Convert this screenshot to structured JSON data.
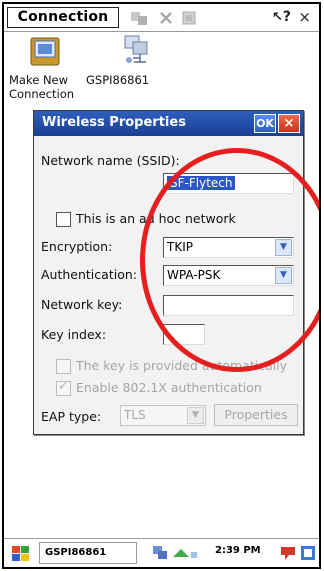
{
  "menubar": {
    "title": "Connection",
    "help_symbol": "?",
    "close_symbol": "×"
  },
  "desktop": {
    "icons": [
      {
        "label_line1": "Make New",
        "label_line2": "Connection",
        "icon": "network-folder-icon"
      },
      {
        "label_line1": "GSPI86861",
        "icon": "wireless-connection-icon"
      }
    ]
  },
  "dialog": {
    "title": "Wireless Properties",
    "ok_label": "OK",
    "close_symbol": "×",
    "ssid_label": "Network name (SSID):",
    "ssid_value": "SF-Flytech",
    "adhoc_label": "This is an ad hoc network",
    "encryption_label": "Encryption:",
    "encryption_value": "TKIP",
    "authentication_label": "Authentication:",
    "authentication_value": "WPA-PSK",
    "network_key_label": "Network key:",
    "network_key_value": "",
    "key_index_label": "Key index:",
    "key_index_value": "",
    "key_auto_label": "The key is provided automatically",
    "enable_8021x_label": "Enable 802.1X authentication",
    "enable_8021x_checked": true,
    "eap_type_label": "EAP type:",
    "eap_type_value": "TLS",
    "properties_button": "Properties"
  },
  "annotation": {
    "color": "#e51f1f"
  },
  "taskbar": {
    "task_label": "GSPI86861",
    "clock": "2:39 PM"
  }
}
